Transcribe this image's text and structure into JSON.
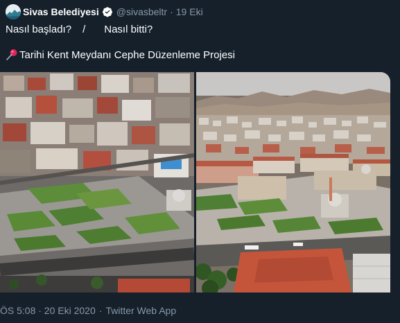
{
  "tweet": {
    "display_name": "Sivas Belediyesi",
    "handle": "@sivasbeltr",
    "separator": "·",
    "relative_date": "19 Eki",
    "text_question_1": "Nasıl başladı?",
    "text_slash": "/",
    "text_question_2": "Nasıl bitti?",
    "pin_emoji": "pushpin-icon",
    "project_title": "Tarihi Kent Meydanı Cephe Düzenleme Projesi",
    "photos": [
      {
        "name": "before-aerial-photo"
      },
      {
        "name": "after-aerial-photo"
      }
    ],
    "footer": {
      "timestamp": "ÖS 5:08 · 20 Eki 2020",
      "separator": "·",
      "app": "Twitter Web App"
    }
  },
  "colors": {
    "background": "#15202b",
    "muted_text": "#8899a6",
    "verified": "#ffffff"
  }
}
